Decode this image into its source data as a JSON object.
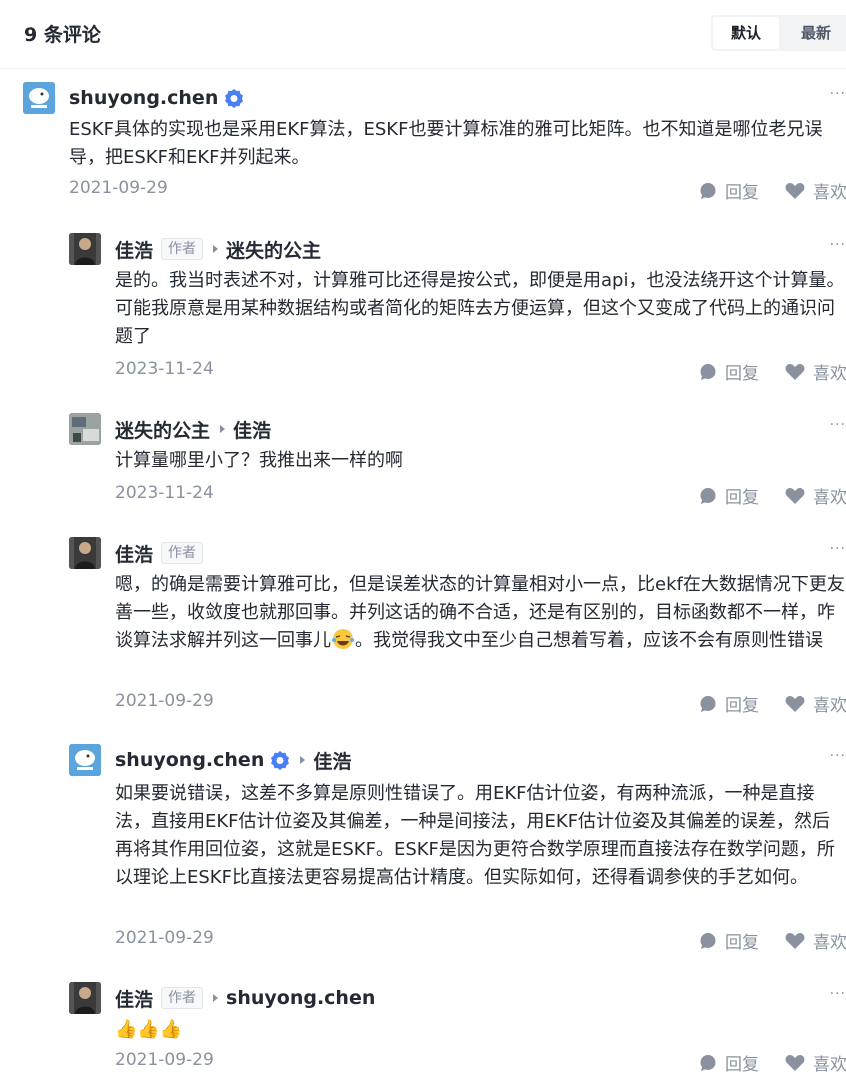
{
  "header": {
    "count_title": "9 条评论",
    "sort_default": "默认",
    "sort_latest": "最新"
  },
  "labels": {
    "author_badge": "作者",
    "reply": "回复",
    "like": "喜欢",
    "more": "···"
  },
  "comments": [
    {
      "user": "shuyong.chen",
      "content": "ESKF具体的实现也是采用EKF算法，ESKF也要计算标准的雅可比矩阵。也不知道是哪位老兄误导，把ESKF和EKF并列起来。",
      "date": "2021-09-29"
    },
    {
      "user": "佳浩",
      "reply_to": "迷失的公主",
      "content": "是的。我当时表述不对，计算雅可比还得是按公式，即便是用api，也没法绕开这个计算量。可能我原意是用某种数据结构或者简化的矩阵去方便运算，但这个又变成了代码上的通识问题了",
      "date": "2023-11-24"
    },
    {
      "user": "迷失的公主",
      "reply_to": "佳浩",
      "content": "计算量哪里小了？我推出来一样的啊",
      "date": "2023-11-24"
    },
    {
      "user": "佳浩",
      "content": "嗯，的确是需要计算雅可比，但是误差状态的计算量相对小一点，比ekf在大数据情况下更友善一些，收敛度也就那回事。并列这话的确不合适，还是有区别的，目标函数都不一样，咋谈算法求解并列这一回事儿",
      "content_tail": "。我觉得我文中至少自己想着写着，应该不会有原则性错误",
      "date": "2021-09-29"
    },
    {
      "user": "shuyong.chen",
      "reply_to": "佳浩",
      "content": "如果要说错误，这差不多算是原则性错误了。用EKF估计位姿，有两种流派，一种是直接法，直接用EKF估计位姿及其偏差，一种是间接法，用EKF估计位姿及其偏差的误差，然后再将其作用回位姿，这就是ESKF。ESKF是因为更符合数学原理而直接法存在数学问题，所以理论上ESKF比直接法更容易提高估计精度。但实际如何，还得看调参侠的手艺如何。",
      "date": "2021-09-29"
    },
    {
      "user": "佳浩",
      "reply_to": "shuyong.chen",
      "content": "👍👍👍",
      "date": "2021-09-29"
    }
  ],
  "colors": {
    "text": "#252933",
    "muted": "#8a919f",
    "verified": "#1e80ff",
    "emoji": "#f9c940"
  },
  "icons": [
    "verified-icon",
    "reply-arrow-icon",
    "more-icon",
    "reply-icon",
    "like-icon",
    "laugh-emoji-icon"
  ]
}
